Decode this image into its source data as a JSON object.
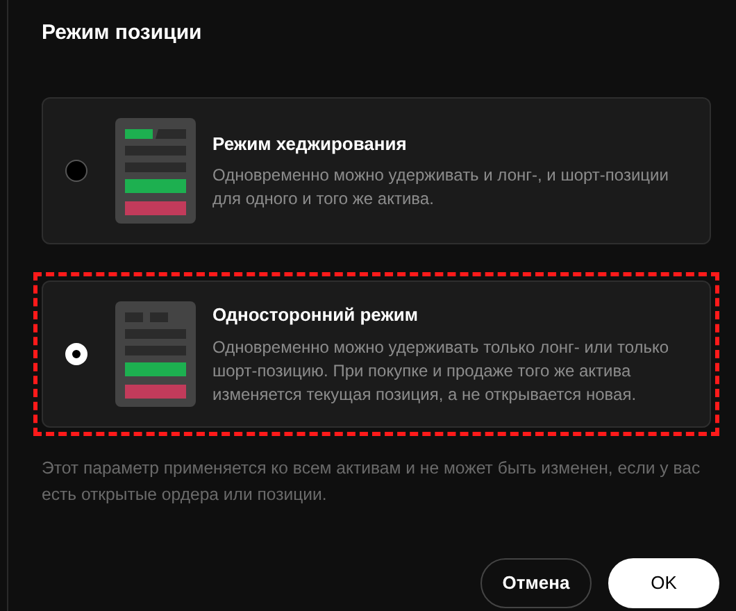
{
  "dialog": {
    "title": "Режим позиции"
  },
  "options": [
    {
      "kind": "hedge",
      "title": "Режим хеджирования",
      "description": "Одновременно можно удерживать и лонг-, и шорт-позиции для одного и того же актива.",
      "selected": false,
      "highlighted": false
    },
    {
      "kind": "oneway",
      "title": "Односторонний режим",
      "description": "Одновременно можно удерживать только лонг- или только шорт-позицию. При покупке и продаже того же актива изменяется текущая позиция, а не открывается новая.",
      "selected": true,
      "highlighted": true
    }
  ],
  "note": "Этот параметр применяется ко всем активам и не может быть изменен, если у вас есть открытые ордера или позиции.",
  "buttons": [
    {
      "kind": "secondary",
      "label": "Отмена"
    },
    {
      "kind": "primary",
      "label": "OK"
    }
  ]
}
